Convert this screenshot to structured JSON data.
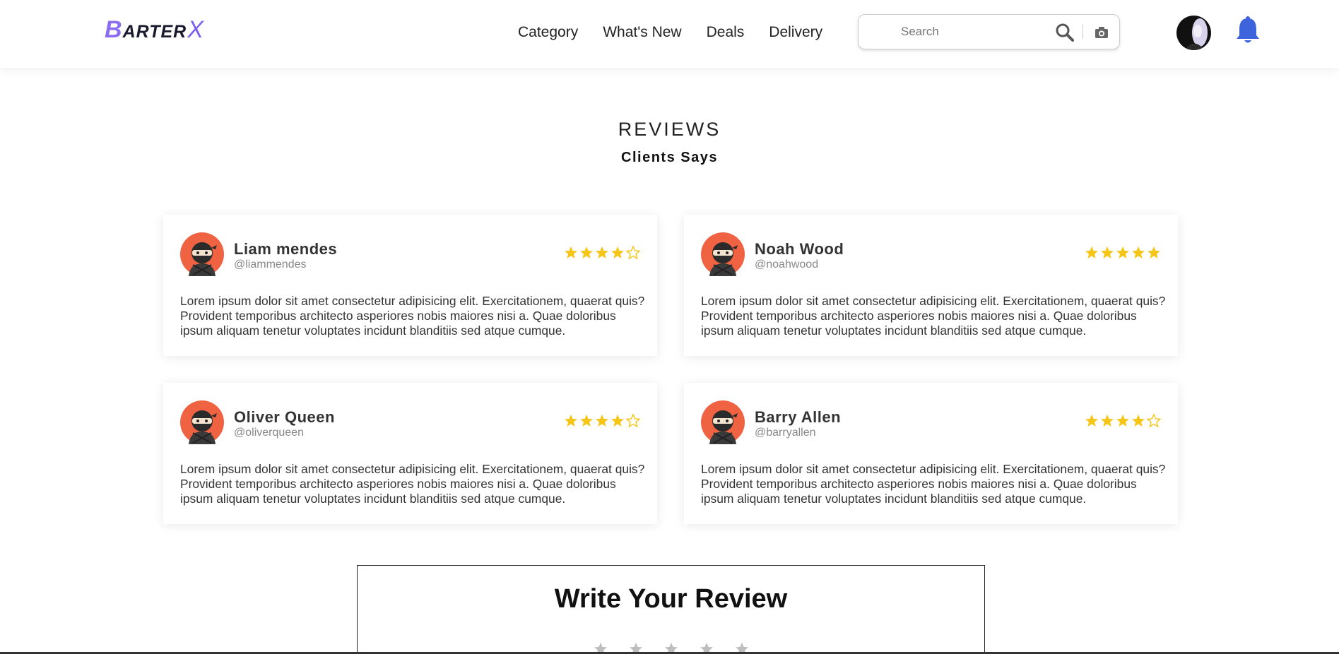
{
  "header": {
    "logo": {
      "letter": "B",
      "text": "ARTER",
      "x_letter": "X"
    },
    "nav": [
      "Category",
      "What's New",
      "Deals",
      "Delivery"
    ],
    "search": {
      "placeholder": "Search",
      "value": ""
    }
  },
  "reviews": {
    "title": "REVIEWS",
    "subtitle": "Clients Says",
    "cards": [
      {
        "name": "Liam mendes",
        "handle": "@liammendes",
        "rating": 4,
        "text": "Lorem ipsum dolor sit amet consectetur adipisicing elit. Exercitationem, quaerat quis? Provident temporibus architecto asperiores nobis maiores nisi a. Quae doloribus ipsum aliquam tenetur voluptates incidunt blanditiis sed atque cumque."
      },
      {
        "name": "Noah Wood",
        "handle": "@noahwood",
        "rating": 5,
        "text": "Lorem ipsum dolor sit amet consectetur adipisicing elit. Exercitationem, quaerat quis? Provident temporibus architecto asperiores nobis maiores nisi a. Quae doloribus ipsum aliquam tenetur voluptates incidunt blanditiis sed atque cumque."
      },
      {
        "name": "Oliver Queen",
        "handle": "@oliverqueen",
        "rating": 4,
        "text": "Lorem ipsum dolor sit amet consectetur adipisicing elit. Exercitationem, quaerat quis? Provident temporibus architecto asperiores nobis maiores nisi a. Quae doloribus ipsum aliquam tenetur voluptates incidunt blanditiis sed atque cumque."
      },
      {
        "name": "Barry Allen",
        "handle": "@barryallen",
        "rating": 4,
        "text": "Lorem ipsum dolor sit amet consectetur adipisicing elit. Exercitationem, quaerat quis? Provident temporibus architecto asperiores nobis maiores nisi a. Quae doloribus ipsum aliquam tenetur voluptates incidunt blanditiis sed atque cumque."
      }
    ]
  },
  "write_review": {
    "title": "Write Your Review",
    "rating_stars": 5
  },
  "colors": {
    "star_filled": "#f5c518",
    "star_empty": "#f5c518",
    "bell": "#3d63dd",
    "logo_accent": "#8a6df0",
    "avatar_bg": "#ef6342"
  },
  "icons": {
    "search": "search-icon",
    "camera": "camera-icon",
    "bell": "bell-icon",
    "user_avatar": "user-avatar",
    "reviewer_avatar": "ninja-avatar-icon",
    "star_full": "star-filled-icon",
    "star_outline": "star-outline-icon"
  }
}
